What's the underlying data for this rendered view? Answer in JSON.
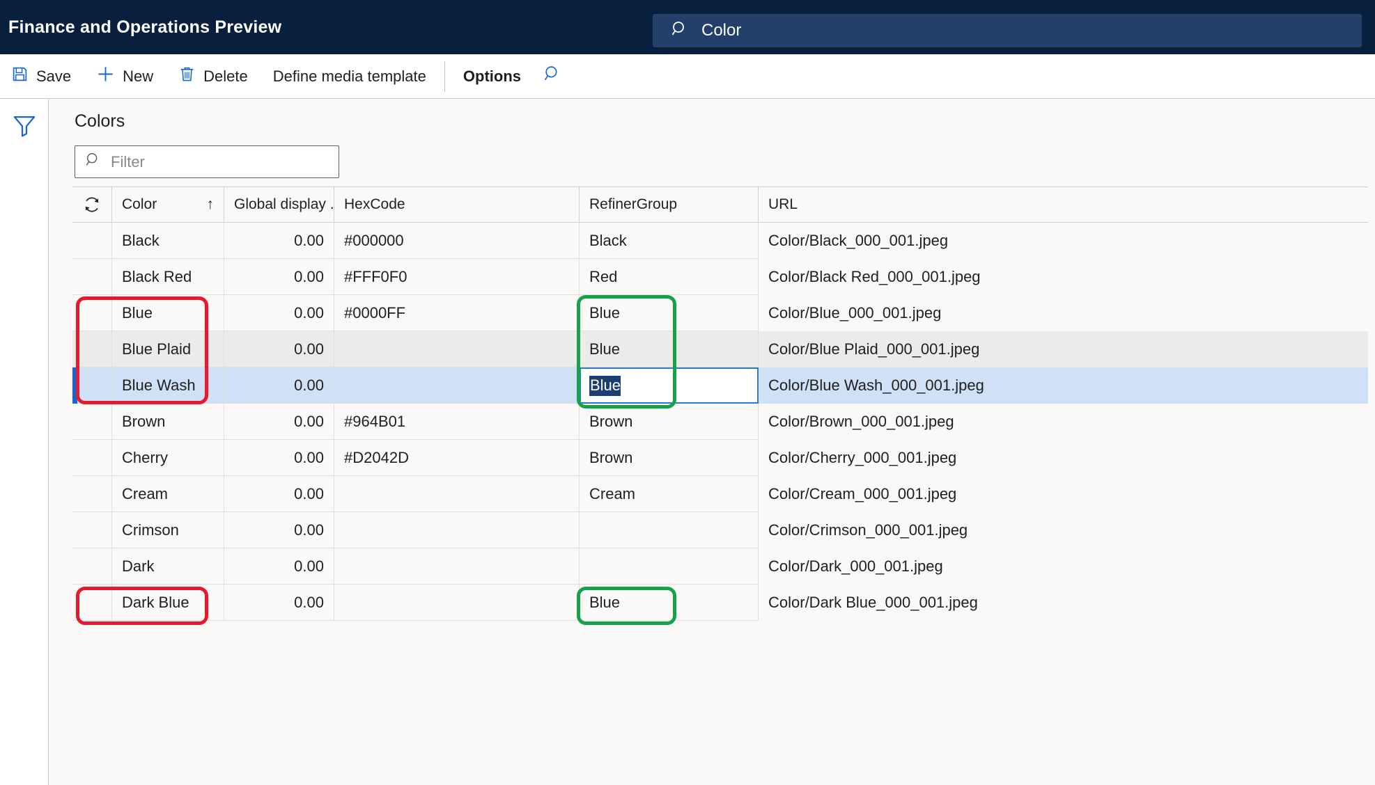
{
  "appbar": {
    "title": "Finance and Operations Preview",
    "search": {
      "value": "Color",
      "icon": "search-icon"
    }
  },
  "toolbar": {
    "buttons": [
      {
        "label": "Save",
        "icon": "save-icon"
      },
      {
        "label": "New",
        "icon": "plus-icon"
      },
      {
        "label": "Delete",
        "icon": "trash-icon"
      },
      {
        "label": "Define media template",
        "icon": ""
      },
      {
        "label": "Options",
        "icon": ""
      }
    ],
    "search_icon": "search-icon"
  },
  "filter_pane": {
    "icon": "funnel-icon"
  },
  "page": {
    "heading": "Colors",
    "filter": {
      "placeholder": "Filter",
      "value": "",
      "icon": "search-icon"
    }
  },
  "grid": {
    "columns": [
      {
        "key": "refresh",
        "label": "",
        "icon": "refresh-icon"
      },
      {
        "key": "color",
        "label": "Color",
        "sort": "↑"
      },
      {
        "key": "global",
        "label": "Global display ..."
      },
      {
        "key": "hex",
        "label": "HexCode"
      },
      {
        "key": "refiner",
        "label": "RefinerGroup"
      },
      {
        "key": "url",
        "label": "URL"
      }
    ],
    "rows": [
      {
        "color": "Black",
        "global": "0.00",
        "hex": "#000000",
        "refiner": "Black",
        "url": "Color/Black_000_001.jpeg",
        "state": "normal"
      },
      {
        "color": "Black Red",
        "global": "0.00",
        "hex": "#FFF0F0",
        "refiner": "Red",
        "url": "Color/Black Red_000_001.jpeg",
        "state": "normal"
      },
      {
        "color": "Blue",
        "global": "0.00",
        "hex": "#0000FF",
        "refiner": "Blue",
        "url": "Color/Blue_000_001.jpeg",
        "state": "normal"
      },
      {
        "color": "Blue Plaid",
        "global": "0.00",
        "hex": "",
        "refiner": "Blue",
        "url": "Color/Blue Plaid_000_001.jpeg",
        "state": "alt"
      },
      {
        "color": "Blue Wash",
        "global": "0.00",
        "hex": "",
        "refiner": "Blue",
        "url": "Color/Blue Wash_000_001.jpeg",
        "state": "selected",
        "editing": "refiner"
      },
      {
        "color": "Brown",
        "global": "0.00",
        "hex": "#964B01",
        "refiner": "Brown",
        "url": "Color/Brown_000_001.jpeg",
        "state": "normal"
      },
      {
        "color": "Cherry",
        "global": "0.00",
        "hex": "#D2042D",
        "refiner": "Brown",
        "url": "Color/Cherry_000_001.jpeg",
        "state": "normal"
      },
      {
        "color": "Cream",
        "global": "0.00",
        "hex": "",
        "refiner": "Cream",
        "url": "Color/Cream_000_001.jpeg",
        "state": "normal"
      },
      {
        "color": "Crimson",
        "global": "0.00",
        "hex": "",
        "refiner": "",
        "url": "Color/Crimson_000_001.jpeg",
        "state": "normal"
      },
      {
        "color": "Dark",
        "global": "0.00",
        "hex": "",
        "refiner": "",
        "url": "Color/Dark_000_001.jpeg",
        "state": "normal"
      },
      {
        "color": "Dark Blue",
        "global": "0.00",
        "hex": "",
        "refiner": "Blue",
        "url": "Color/Dark Blue_000_001.jpeg",
        "state": "normal"
      }
    ]
  },
  "annotations": {
    "red_color": "#E8192C",
    "green_color": "#15A24A",
    "boxes": [
      {
        "color": "red",
        "target": "color-cells-blue-group"
      },
      {
        "color": "green",
        "target": "refiner-cells-blue-group"
      },
      {
        "color": "red",
        "target": "color-cell-dark-blue"
      },
      {
        "color": "green",
        "target": "refiner-cell-dark-blue"
      }
    ]
  }
}
